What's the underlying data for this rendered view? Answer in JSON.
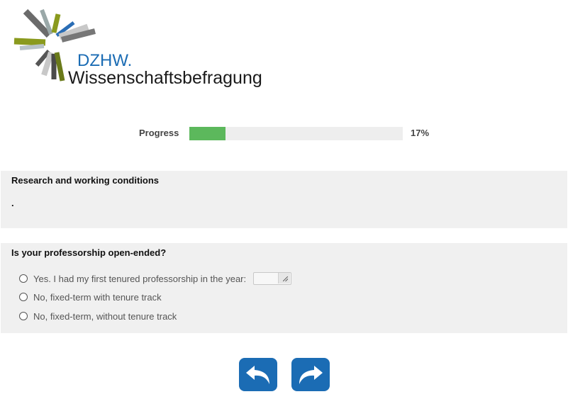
{
  "brand": {
    "org": "DZHW.",
    "name": "Wissenschaftsbefragung",
    "org_color": "#1b6cb4"
  },
  "progress": {
    "label": "Progress",
    "value_percent": 17,
    "percent_text": "17%",
    "fill_color": "#5cb85c"
  },
  "section_intro": {
    "title": "Research and working conditions",
    "text": "."
  },
  "question": {
    "title": "Is your professorship open-ended?",
    "options": [
      {
        "label": "Yes. I had my first tenured professorship in the year:",
        "has_input": true,
        "input_value": ""
      },
      {
        "label": "No, fixed-term with tenure track"
      },
      {
        "label": "No, fixed-term, without tenure track"
      }
    ]
  },
  "navigation": {
    "back_icon": "back-arrow-icon",
    "next_icon": "forward-arrow-icon",
    "button_color": "#1b6cb4"
  }
}
